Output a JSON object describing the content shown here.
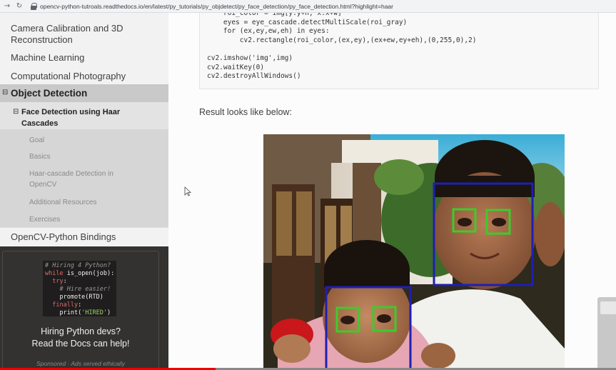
{
  "browser": {
    "url": "opencv-python-tutroals.readthedocs.io/en/latest/py_tutorials/py_objdetect/py_face_detection/py_face_detection.html?highlight=haar",
    "back_icon": "back-arrow-icon",
    "forward_icon": "forward-arrow-icon",
    "reload_icon": "reload-icon",
    "lock_icon": "lock-icon"
  },
  "sidebar": {
    "items": [
      {
        "label": "Camera Calibration and 3D Reconstruction"
      },
      {
        "label": "Machine Learning"
      },
      {
        "label": "Computational Photography"
      }
    ],
    "current": {
      "toggle": "⊟",
      "label": "Object Detection",
      "sub": {
        "toggle": "⊟",
        "label": "Face Detection using Haar Cascades",
        "children": [
          {
            "label": "Goal"
          },
          {
            "label": "Basics"
          },
          {
            "label": "Haar-cascade Detection in OpenCV"
          },
          {
            "label": "Additional Resources"
          },
          {
            "label": "Exercises"
          }
        ]
      }
    },
    "bottom_item": "OpenCV-Python Bindings"
  },
  "ad": {
    "code_lines": [
      {
        "parts": [
          {
            "t": "# Hiring 4 Python?",
            "c": "c-comment"
          }
        ]
      },
      {
        "parts": [
          {
            "t": "while ",
            "c": "c-kw"
          },
          {
            "t": "is_open",
            "c": "c-fn"
          },
          {
            "t": "(job):",
            "c": "c-fn"
          }
        ]
      },
      {
        "parts": [
          {
            "t": "  try",
            "c": "c-kw"
          },
          {
            "t": ":",
            "c": "c-fn"
          }
        ]
      },
      {
        "parts": [
          {
            "t": "    # Hire easier!",
            "c": "c-comment"
          }
        ]
      },
      {
        "parts": [
          {
            "t": "    promote",
            "c": "c-fn"
          },
          {
            "t": "(RTD)",
            "c": "c-fn"
          }
        ]
      },
      {
        "parts": [
          {
            "t": "  finally",
            "c": "c-kw"
          },
          {
            "t": ":",
            "c": "c-fn"
          }
        ]
      },
      {
        "parts": [
          {
            "t": "    print",
            "c": "c-fn"
          },
          {
            "t": "(",
            "c": "c-fn"
          },
          {
            "t": "'HIRED'",
            "c": "c-str"
          },
          {
            "t": ")",
            "c": "c-fn"
          }
        ]
      }
    ],
    "title_line1": "Hiring Python devs?",
    "title_line2": "Read the Docs can help!",
    "footer": "Sponsored · Ads served ethically"
  },
  "main": {
    "code": [
      "    roi_color = img[y:y+h, x:x+w]",
      "    eyes = eye_cascade.detectMultiScale(roi_gray)",
      "    for (ex,ey,ew,eh) in eyes:",
      "        cv2.rectangle(roi_color,(ex,ey),(ex+ew,ey+eh),(0,255,0),2)",
      "",
      "cv2.imshow('img',img)",
      "cv2.waitKey(0)",
      "cv2.destroyAllWindows()"
    ],
    "result_text": "Result looks like below:"
  },
  "colors": {
    "face_box": "#1f1fb4",
    "eye_box": "#3ccc2a",
    "video_progress": "#ee0000"
  },
  "video_progress": 0.35
}
